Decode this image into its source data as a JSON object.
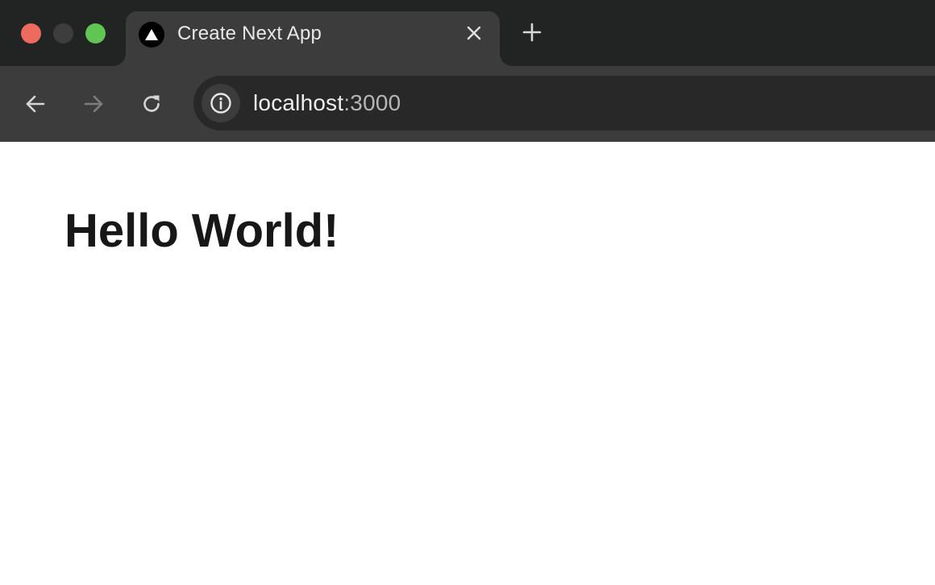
{
  "browser": {
    "window_controls": {
      "close_color": "#ec6a5e",
      "minimize_color": "#3d3d3d",
      "maximize_color": "#61c554"
    },
    "tabs": [
      {
        "title": "Create Next App",
        "favicon": "nextjs-triangle-icon",
        "active": true
      }
    ],
    "new_tab_icon": "plus-icon",
    "toolbar": {
      "back_icon": "arrow-left-icon",
      "forward_icon": "arrow-right-icon",
      "reload_icon": "reload-icon",
      "site_info_icon": "info-icon"
    },
    "address_bar": {
      "host": "localhost",
      "port": ":3000"
    }
  },
  "page": {
    "heading": "Hello World!"
  }
}
